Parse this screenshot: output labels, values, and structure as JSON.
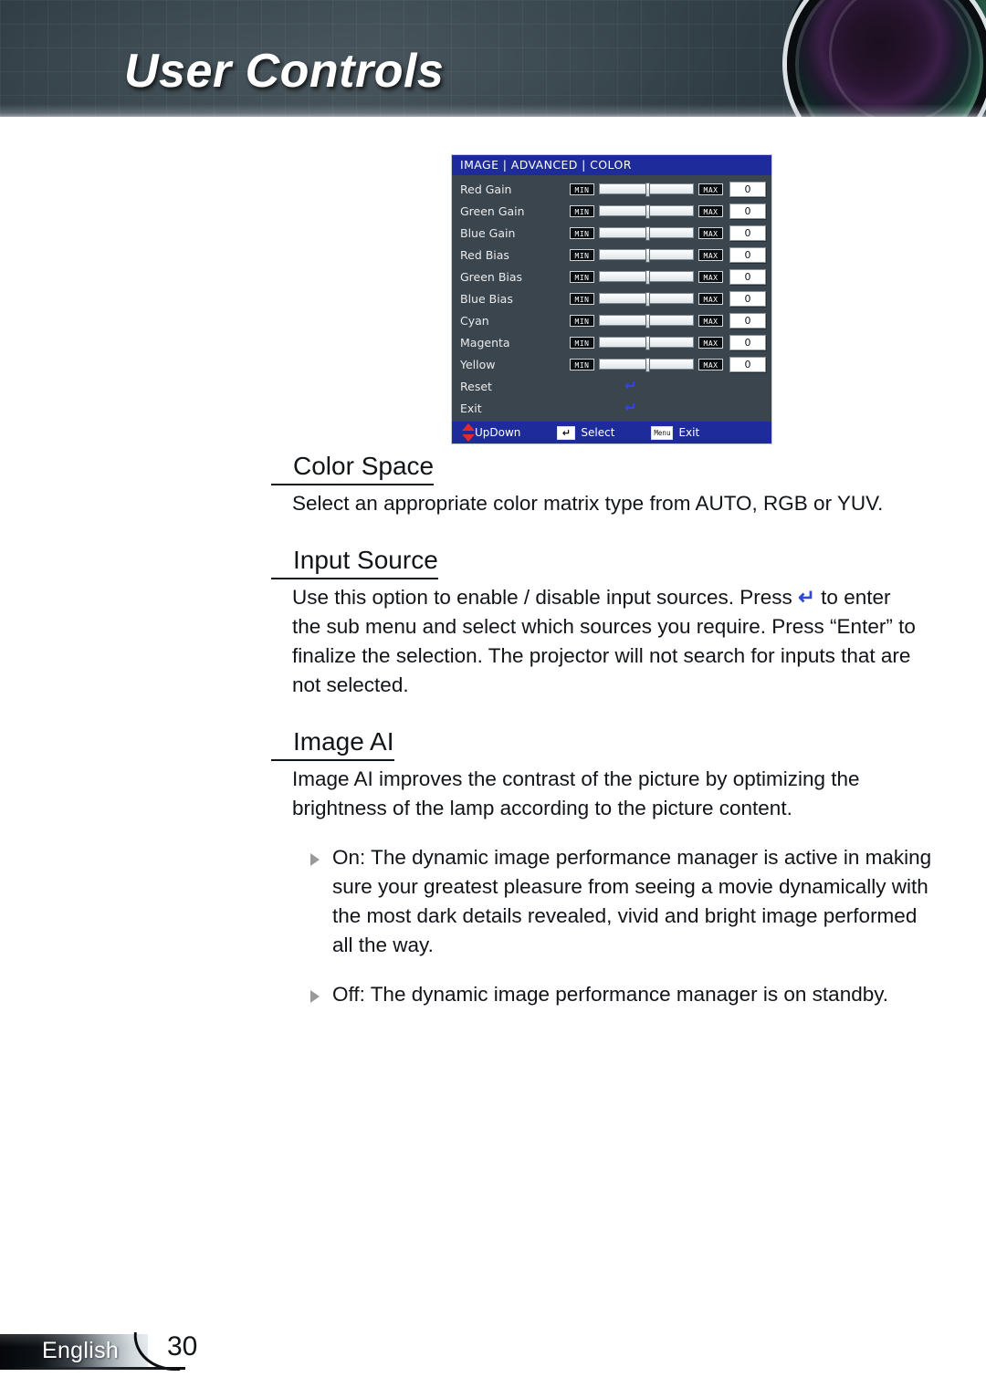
{
  "header": {
    "title": "User Controls",
    "lens_icon": "camera-lens-graphic"
  },
  "osd": {
    "title": "IMAGE | ADVANCED | COLOR",
    "min_label": "MIN",
    "max_label": "MAX",
    "rows": [
      {
        "label": "Red Gain",
        "value": "0"
      },
      {
        "label": "Green Gain",
        "value": "0"
      },
      {
        "label": "Blue Gain",
        "value": "0"
      },
      {
        "label": "Red Bias",
        "value": "0"
      },
      {
        "label": "Green Bias",
        "value": "0"
      },
      {
        "label": "Blue Bias",
        "value": "0"
      },
      {
        "label": "Cyan",
        "value": "0"
      },
      {
        "label": "Magenta",
        "value": "0"
      },
      {
        "label": "Yellow",
        "value": "0"
      }
    ],
    "actions": [
      {
        "label": "Reset",
        "glyph": "↵"
      },
      {
        "label": "Exit",
        "glyph": "↵"
      }
    ],
    "footer": {
      "updown": "UpDown",
      "select": "Select",
      "select_key": "↵",
      "exit": "Exit",
      "exit_key": "Menu"
    },
    "colors": {
      "title_bar": "#1d2b9b",
      "body": "#3a454e",
      "accent_arrow": "#2c49d8",
      "updown_arrow": "#e12b2b"
    }
  },
  "sections": [
    {
      "heading": "Color Space",
      "body": "Select an appropriate color matrix type from AUTO, RGB or YUV."
    },
    {
      "heading": "Input Source",
      "body_pre": "Use this option to enable / disable input sources. Press ",
      "body_glyph": "↵",
      "body_post": " to enter the sub menu and select which sources you require. Press “Enter” to finalize the selection. The projector will not search for inputs that are not selected."
    },
    {
      "heading": "Image AI",
      "body": "Image AI improves the contrast of the picture by optimizing the brightness of the lamp according to the picture content.",
      "bullets": [
        "On: The dynamic image performance manager is active in making sure your greatest pleasure from seeing a movie dynamically with the most dark details revealed, vivid and bright image performed all the way.",
        "Off: The dynamic image performance manager is on standby."
      ]
    }
  ],
  "footer": {
    "language": "English",
    "page_number": "30"
  }
}
